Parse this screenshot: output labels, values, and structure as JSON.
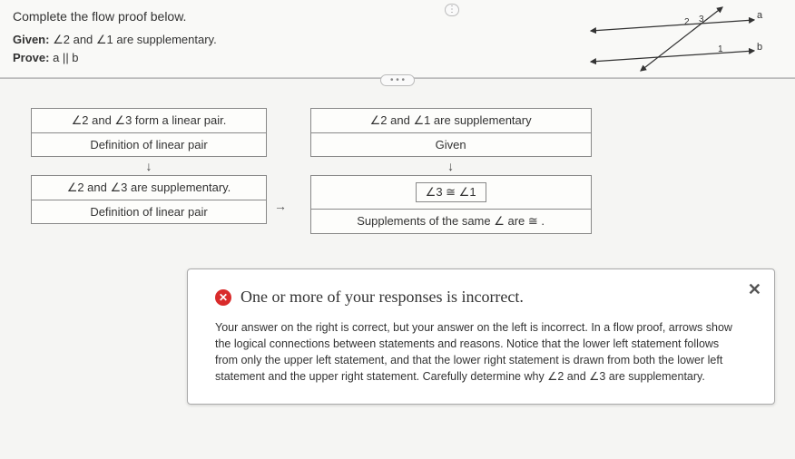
{
  "header": {
    "instruction": "Complete the flow proof below.",
    "given_label": "Given:",
    "given_text": "∠2 and ∠1 are supplementary.",
    "prove_label": "Prove:",
    "prove_text": "a || b"
  },
  "diagram": {
    "labels": {
      "a": "a",
      "b": "b",
      "ang1": "1",
      "ang2": "2",
      "ang3": "3"
    }
  },
  "divider_dots": "• • •",
  "vert_dots": "⋮",
  "flow": {
    "left": {
      "box1": {
        "statement": "∠2 and ∠3 form a linear pair.",
        "reason": "Definition of linear pair"
      },
      "box2": {
        "statement": "∠2 and ∠3 are supplementary.",
        "reason": "Definition of linear pair"
      }
    },
    "right": {
      "box1": {
        "statement": "∠2 and ∠1 are supplementary",
        "reason": "Given"
      },
      "box2": {
        "statement": "∠3 ≅ ∠1",
        "reason": "Supplements of the same ∠ are ≅ ."
      }
    },
    "arrow_down": "↓",
    "arrow_right": "→"
  },
  "feedback": {
    "icon": "✕",
    "title": "One or more of your responses is incorrect.",
    "body": "Your answer on the right is correct, but your answer on the left is incorrect. In a flow proof, arrows show the logical connections between statements and reasons. Notice that the lower left statement follows from only the upper left statement, and that the lower right statement is drawn from both the lower left statement and the upper right statement. Carefully determine why ∠2 and ∠3 are supplementary.",
    "close": "✕"
  }
}
